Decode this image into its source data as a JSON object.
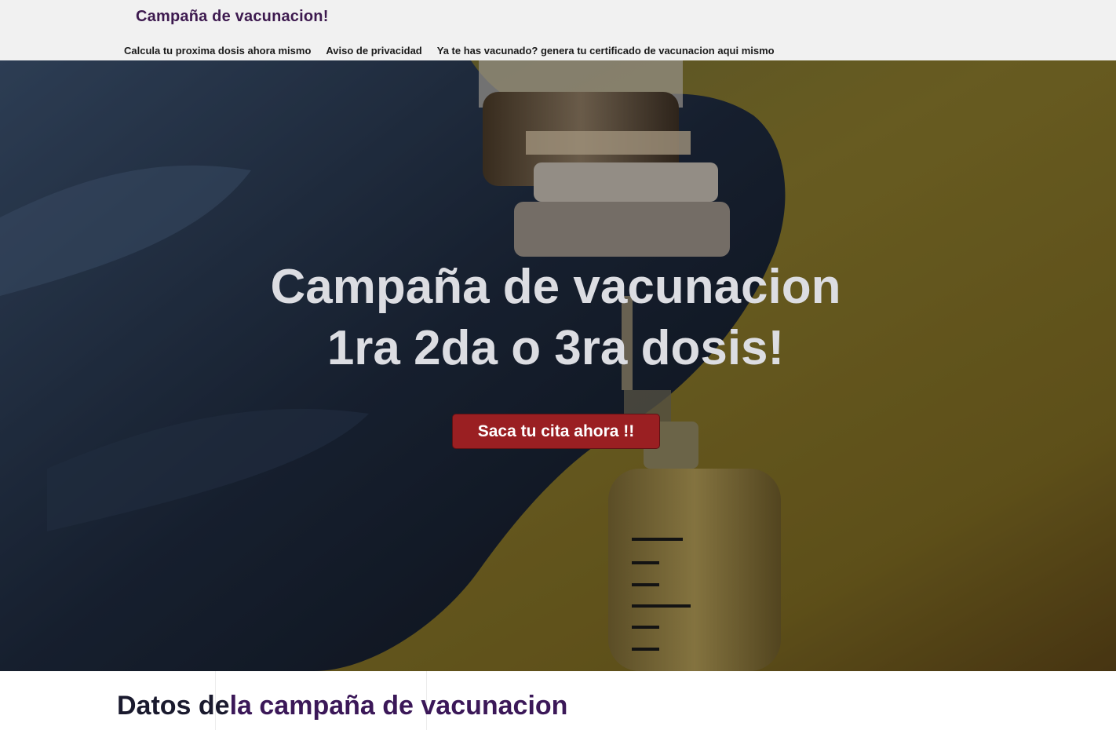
{
  "header": {
    "brand": "Campaña de vacunacion!",
    "nav": [
      {
        "label": "Calcula tu proxima dosis ahora mismo"
      },
      {
        "label": "Aviso de privacidad"
      },
      {
        "label": "Ya te has vacunado? genera tu certificado de vacunacion aqui mismo"
      }
    ]
  },
  "hero": {
    "title_line1": "Campaña de vacunacion",
    "title_line2": "1ra 2da o 3ra dosis!",
    "cta_label": "Saca tu cita ahora !!"
  },
  "section": {
    "title_part1": "Datos de",
    "title_part2": "la campaña de vacunacion"
  },
  "colors": {
    "brand": "#3d1a4f",
    "cta": "#9a1f22",
    "header_bg": "#f1f1f1",
    "hero_text": "#dcdde2"
  }
}
